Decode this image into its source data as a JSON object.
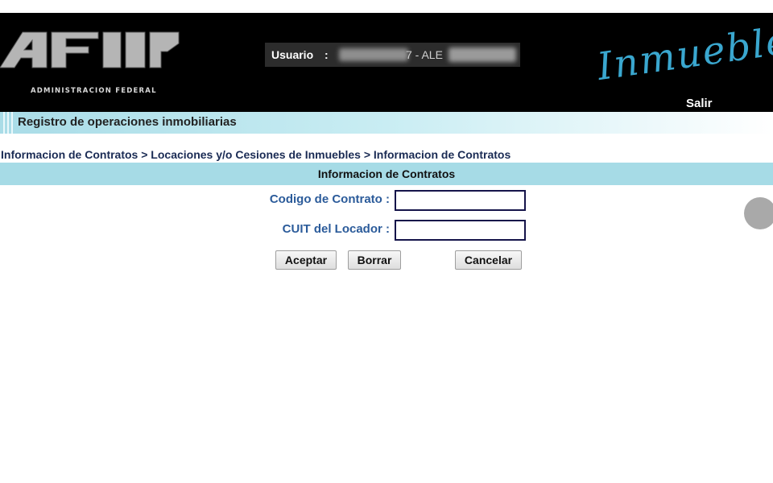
{
  "header": {
    "logo_text": "AFIP",
    "logo_subtitle": "ADMINISTRACION FEDERAL",
    "user_label": "Usuario",
    "user_separator": ":",
    "user_value": "7 - ALE",
    "brand_title": "Inmuebles",
    "logout_label": "Salir",
    "brand_color": "#3aa7cf"
  },
  "subheader": {
    "title": "Registro de operaciones inmobiliarias"
  },
  "breadcrumb": "Informacion de Contratos > Locaciones y/o Cesiones de Inmuebles > Informacion de Contratos",
  "section": {
    "title": "Informacion de Contratos"
  },
  "form": {
    "contract_code_label": "Codigo de Contrato  :",
    "contract_code_value": "",
    "cuit_label": "CUIT del Locador  :",
    "cuit_value": ""
  },
  "buttons": {
    "accept": "Aceptar",
    "clear": "Borrar",
    "cancel": "Cancelar"
  }
}
